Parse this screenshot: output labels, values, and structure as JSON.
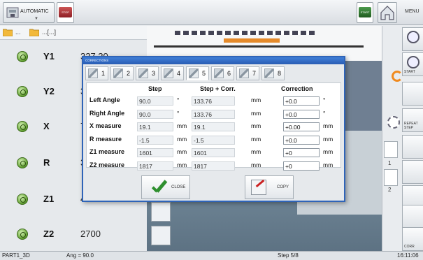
{
  "toolbar": {
    "mode_label": "AUTOMATIC",
    "stop_label": "STOP",
    "start_label": "START",
    "menu_label": "MENU"
  },
  "subbar": {
    "item1": "...",
    "item2": "...[...]"
  },
  "axes": [
    {
      "name": "Y1",
      "value": "327.20"
    },
    {
      "name": "Y2",
      "value": "3"
    },
    {
      "name": "X",
      "value": "7"
    },
    {
      "name": "R",
      "value": "3"
    },
    {
      "name": "Z1",
      "value": "4"
    },
    {
      "name": "Z2",
      "value": "2700"
    }
  ],
  "right_panel": {
    "start_small": "START",
    "repeat_step": "REPEAT STEP",
    "num1": "1",
    "num2": "2",
    "correct": "CORR"
  },
  "dialog": {
    "title": "CORRECTIONS",
    "tabs": [
      "1",
      "2",
      "3",
      "4",
      "5",
      "6",
      "7",
      "8"
    ],
    "active_tab": "5",
    "headers": {
      "step": "Step",
      "step_corr": "Step + Corr.",
      "correction": "Correction"
    },
    "rows": [
      {
        "label": "Left Angle",
        "step": "90.0",
        "step_unit": "°",
        "corr_total": "133.76",
        "corr_unit": "mm",
        "correction": "+0.0",
        "correction_unit": "°"
      },
      {
        "label": "Right Angle",
        "step": "90.0",
        "step_unit": "°",
        "corr_total": "133.76",
        "corr_unit": "mm",
        "correction": "+0.0",
        "correction_unit": "°"
      },
      {
        "label": "X measure",
        "step": "19.1",
        "step_unit": "mm",
        "corr_total": "19.1",
        "corr_unit": "mm",
        "correction": "+0.00",
        "correction_unit": "mm"
      },
      {
        "label": "R measure",
        "step": "-1.5",
        "step_unit": "mm",
        "corr_total": "-1.5",
        "corr_unit": "mm",
        "correction": "+0.0",
        "correction_unit": "mm"
      },
      {
        "label": "Z1 measure",
        "step": "1601",
        "step_unit": "mm",
        "corr_total": "1601",
        "corr_unit": "mm",
        "correction": "+0",
        "correction_unit": "mm"
      },
      {
        "label": "Z2 measure",
        "step": "1817",
        "step_unit": "mm",
        "corr_total": "1817",
        "corr_unit": "mm",
        "correction": "+0",
        "correction_unit": "mm"
      }
    ],
    "close_label": "CLOSE",
    "copy_label": "COPY"
  },
  "status": {
    "program": "PART1_3D",
    "angle": "Ang = 90.0",
    "step": "Step 5/8",
    "time": "16:11:06"
  }
}
